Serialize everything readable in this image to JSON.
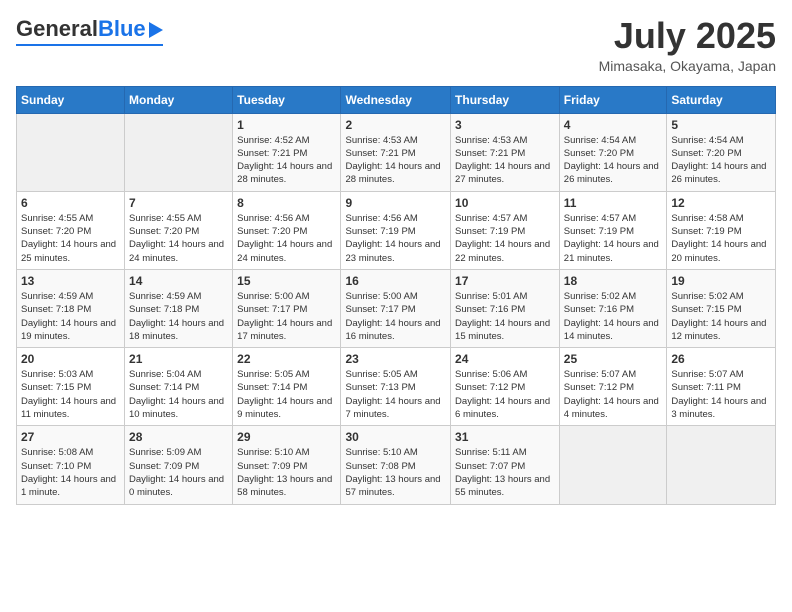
{
  "header": {
    "logo_general": "General",
    "logo_blue": "Blue",
    "month_title": "July 2025",
    "location": "Mimasaka, Okayama, Japan"
  },
  "days_of_week": [
    "Sunday",
    "Monday",
    "Tuesday",
    "Wednesday",
    "Thursday",
    "Friday",
    "Saturday"
  ],
  "weeks": [
    [
      {
        "day": "",
        "info": ""
      },
      {
        "day": "",
        "info": ""
      },
      {
        "day": "1",
        "info": "Sunrise: 4:52 AM\nSunset: 7:21 PM\nDaylight: 14 hours and 28 minutes."
      },
      {
        "day": "2",
        "info": "Sunrise: 4:53 AM\nSunset: 7:21 PM\nDaylight: 14 hours and 28 minutes."
      },
      {
        "day": "3",
        "info": "Sunrise: 4:53 AM\nSunset: 7:21 PM\nDaylight: 14 hours and 27 minutes."
      },
      {
        "day": "4",
        "info": "Sunrise: 4:54 AM\nSunset: 7:20 PM\nDaylight: 14 hours and 26 minutes."
      },
      {
        "day": "5",
        "info": "Sunrise: 4:54 AM\nSunset: 7:20 PM\nDaylight: 14 hours and 26 minutes."
      }
    ],
    [
      {
        "day": "6",
        "info": "Sunrise: 4:55 AM\nSunset: 7:20 PM\nDaylight: 14 hours and 25 minutes."
      },
      {
        "day": "7",
        "info": "Sunrise: 4:55 AM\nSunset: 7:20 PM\nDaylight: 14 hours and 24 minutes."
      },
      {
        "day": "8",
        "info": "Sunrise: 4:56 AM\nSunset: 7:20 PM\nDaylight: 14 hours and 24 minutes."
      },
      {
        "day": "9",
        "info": "Sunrise: 4:56 AM\nSunset: 7:19 PM\nDaylight: 14 hours and 23 minutes."
      },
      {
        "day": "10",
        "info": "Sunrise: 4:57 AM\nSunset: 7:19 PM\nDaylight: 14 hours and 22 minutes."
      },
      {
        "day": "11",
        "info": "Sunrise: 4:57 AM\nSunset: 7:19 PM\nDaylight: 14 hours and 21 minutes."
      },
      {
        "day": "12",
        "info": "Sunrise: 4:58 AM\nSunset: 7:19 PM\nDaylight: 14 hours and 20 minutes."
      }
    ],
    [
      {
        "day": "13",
        "info": "Sunrise: 4:59 AM\nSunset: 7:18 PM\nDaylight: 14 hours and 19 minutes."
      },
      {
        "day": "14",
        "info": "Sunrise: 4:59 AM\nSunset: 7:18 PM\nDaylight: 14 hours and 18 minutes."
      },
      {
        "day": "15",
        "info": "Sunrise: 5:00 AM\nSunset: 7:17 PM\nDaylight: 14 hours and 17 minutes."
      },
      {
        "day": "16",
        "info": "Sunrise: 5:00 AM\nSunset: 7:17 PM\nDaylight: 14 hours and 16 minutes."
      },
      {
        "day": "17",
        "info": "Sunrise: 5:01 AM\nSunset: 7:16 PM\nDaylight: 14 hours and 15 minutes."
      },
      {
        "day": "18",
        "info": "Sunrise: 5:02 AM\nSunset: 7:16 PM\nDaylight: 14 hours and 14 minutes."
      },
      {
        "day": "19",
        "info": "Sunrise: 5:02 AM\nSunset: 7:15 PM\nDaylight: 14 hours and 12 minutes."
      }
    ],
    [
      {
        "day": "20",
        "info": "Sunrise: 5:03 AM\nSunset: 7:15 PM\nDaylight: 14 hours and 11 minutes."
      },
      {
        "day": "21",
        "info": "Sunrise: 5:04 AM\nSunset: 7:14 PM\nDaylight: 14 hours and 10 minutes."
      },
      {
        "day": "22",
        "info": "Sunrise: 5:05 AM\nSunset: 7:14 PM\nDaylight: 14 hours and 9 minutes."
      },
      {
        "day": "23",
        "info": "Sunrise: 5:05 AM\nSunset: 7:13 PM\nDaylight: 14 hours and 7 minutes."
      },
      {
        "day": "24",
        "info": "Sunrise: 5:06 AM\nSunset: 7:12 PM\nDaylight: 14 hours and 6 minutes."
      },
      {
        "day": "25",
        "info": "Sunrise: 5:07 AM\nSunset: 7:12 PM\nDaylight: 14 hours and 4 minutes."
      },
      {
        "day": "26",
        "info": "Sunrise: 5:07 AM\nSunset: 7:11 PM\nDaylight: 14 hours and 3 minutes."
      }
    ],
    [
      {
        "day": "27",
        "info": "Sunrise: 5:08 AM\nSunset: 7:10 PM\nDaylight: 14 hours and 1 minute."
      },
      {
        "day": "28",
        "info": "Sunrise: 5:09 AM\nSunset: 7:09 PM\nDaylight: 14 hours and 0 minutes."
      },
      {
        "day": "29",
        "info": "Sunrise: 5:10 AM\nSunset: 7:09 PM\nDaylight: 13 hours and 58 minutes."
      },
      {
        "day": "30",
        "info": "Sunrise: 5:10 AM\nSunset: 7:08 PM\nDaylight: 13 hours and 57 minutes."
      },
      {
        "day": "31",
        "info": "Sunrise: 5:11 AM\nSunset: 7:07 PM\nDaylight: 13 hours and 55 minutes."
      },
      {
        "day": "",
        "info": ""
      },
      {
        "day": "",
        "info": ""
      }
    ]
  ]
}
